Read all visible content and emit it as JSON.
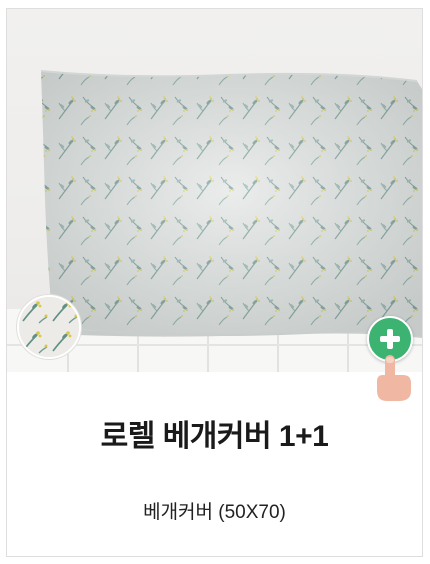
{
  "product": {
    "title": "로렐 베개커버 1+1",
    "option": "베개커버 (50X70)"
  },
  "icons": {
    "add_button": "plus-icon",
    "tap_hint": "pointing-hand-icon",
    "pattern_swatch": "floral-swatch-icon"
  },
  "colors": {
    "accent_green": "#3cb371",
    "pillow_base": "#e4e7e6",
    "leaf": "#7fa39f",
    "flower": "#e2d56a"
  }
}
